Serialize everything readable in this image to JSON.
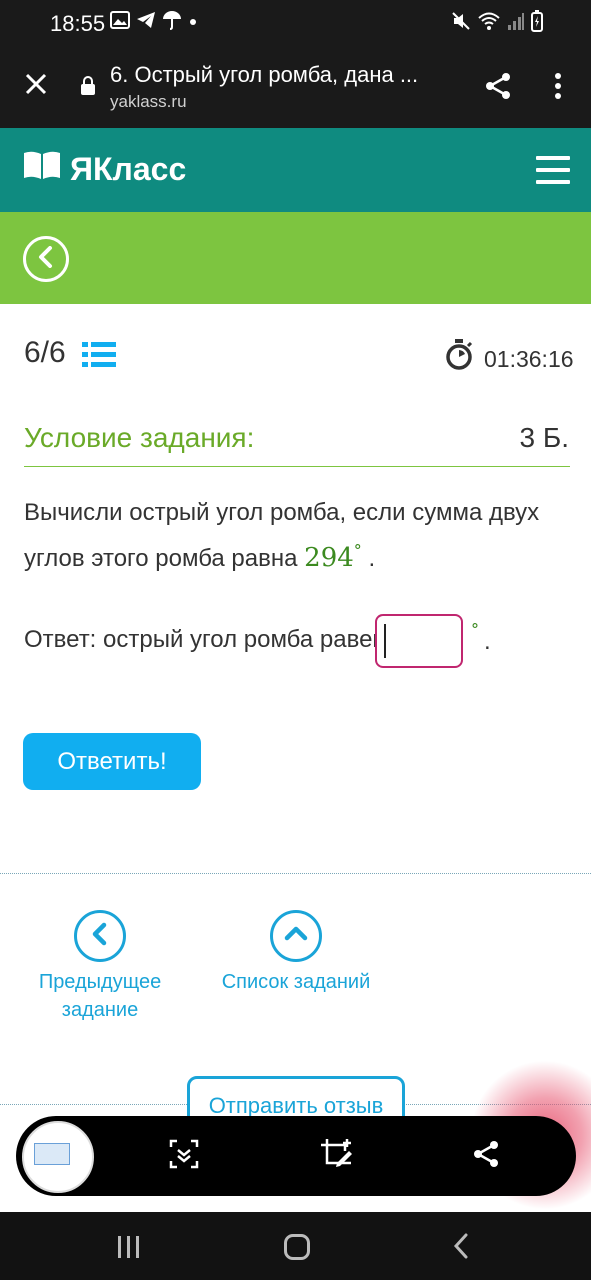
{
  "status_bar": {
    "time": "18:55",
    "left_icons": [
      "image-icon",
      "telegram-icon",
      "umbrella-icon",
      "dot-icon"
    ],
    "right_icons": [
      "mute-icon",
      "wifi-icon",
      "signal-icon",
      "battery-icon"
    ]
  },
  "browser": {
    "title": "6. Острый угол ромба, дана ...",
    "url": "yaklass.ru"
  },
  "site": {
    "logo_text": "ЯКласс",
    "header_color": "#0f8b80",
    "accent_green": "#7dc540"
  },
  "task": {
    "progress": "6/6",
    "timer": "01:36:16",
    "condition_title": "Условие задания:",
    "points": "3 Б.",
    "question_text": "Вычисли острый угол ромба, если сумма двух углов этого ромба равна",
    "question_value": "294",
    "degree_symbol": "°",
    "question_end": ".",
    "answer_label": "Ответ: острый угол ромба равен",
    "answer_value": "",
    "answer_suffix": ".",
    "submit_label": "Ответить!"
  },
  "navigation": {
    "prev_label_line1": "Предыдущее",
    "prev_label_line2": "задание",
    "list_label": "Список заданий",
    "feedback_label": "Отправить отзыв"
  },
  "screenshot_toolbar": {
    "tools": [
      "scroll-capture-icon",
      "crop-edit-icon",
      "share-icon"
    ]
  }
}
